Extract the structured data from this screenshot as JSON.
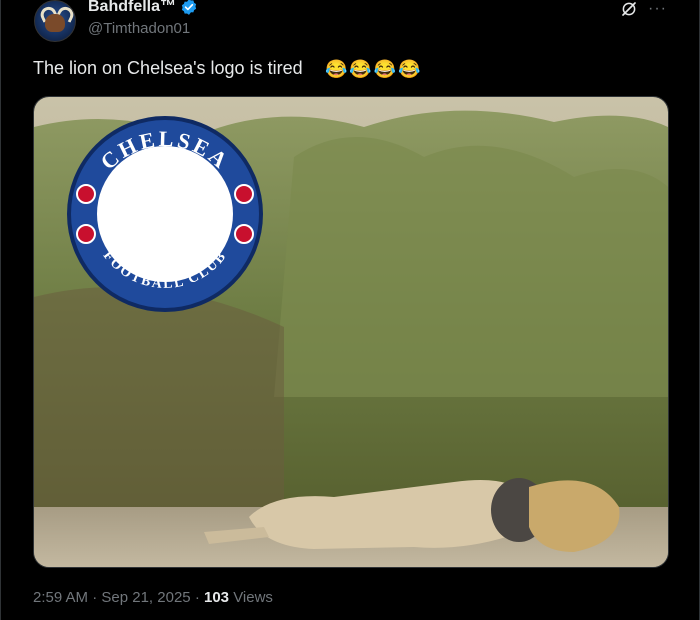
{
  "author": {
    "display_name": "Bahdfella™",
    "handle": "@Timthadon01"
  },
  "tweet": {
    "text": "The lion on Chelsea's logo is tired",
    "emojis": [
      "😂",
      "😂",
      "😂",
      "😂"
    ]
  },
  "media": {
    "badge_top_text": "CHELSEA",
    "badge_bottom_text": "FOOTBALL CLUB"
  },
  "meta": {
    "time": "2:59 AM",
    "separator": "·",
    "date": "Sep 21, 2025",
    "views_count": "103",
    "views_label": "Views"
  },
  "colors": {
    "badge_blue": "#1f4a9c",
    "verified_blue": "#1d9bf0"
  },
  "icons": {
    "verified": "verified-badge-icon",
    "grok": "grok-icon",
    "more": "more-icon"
  }
}
